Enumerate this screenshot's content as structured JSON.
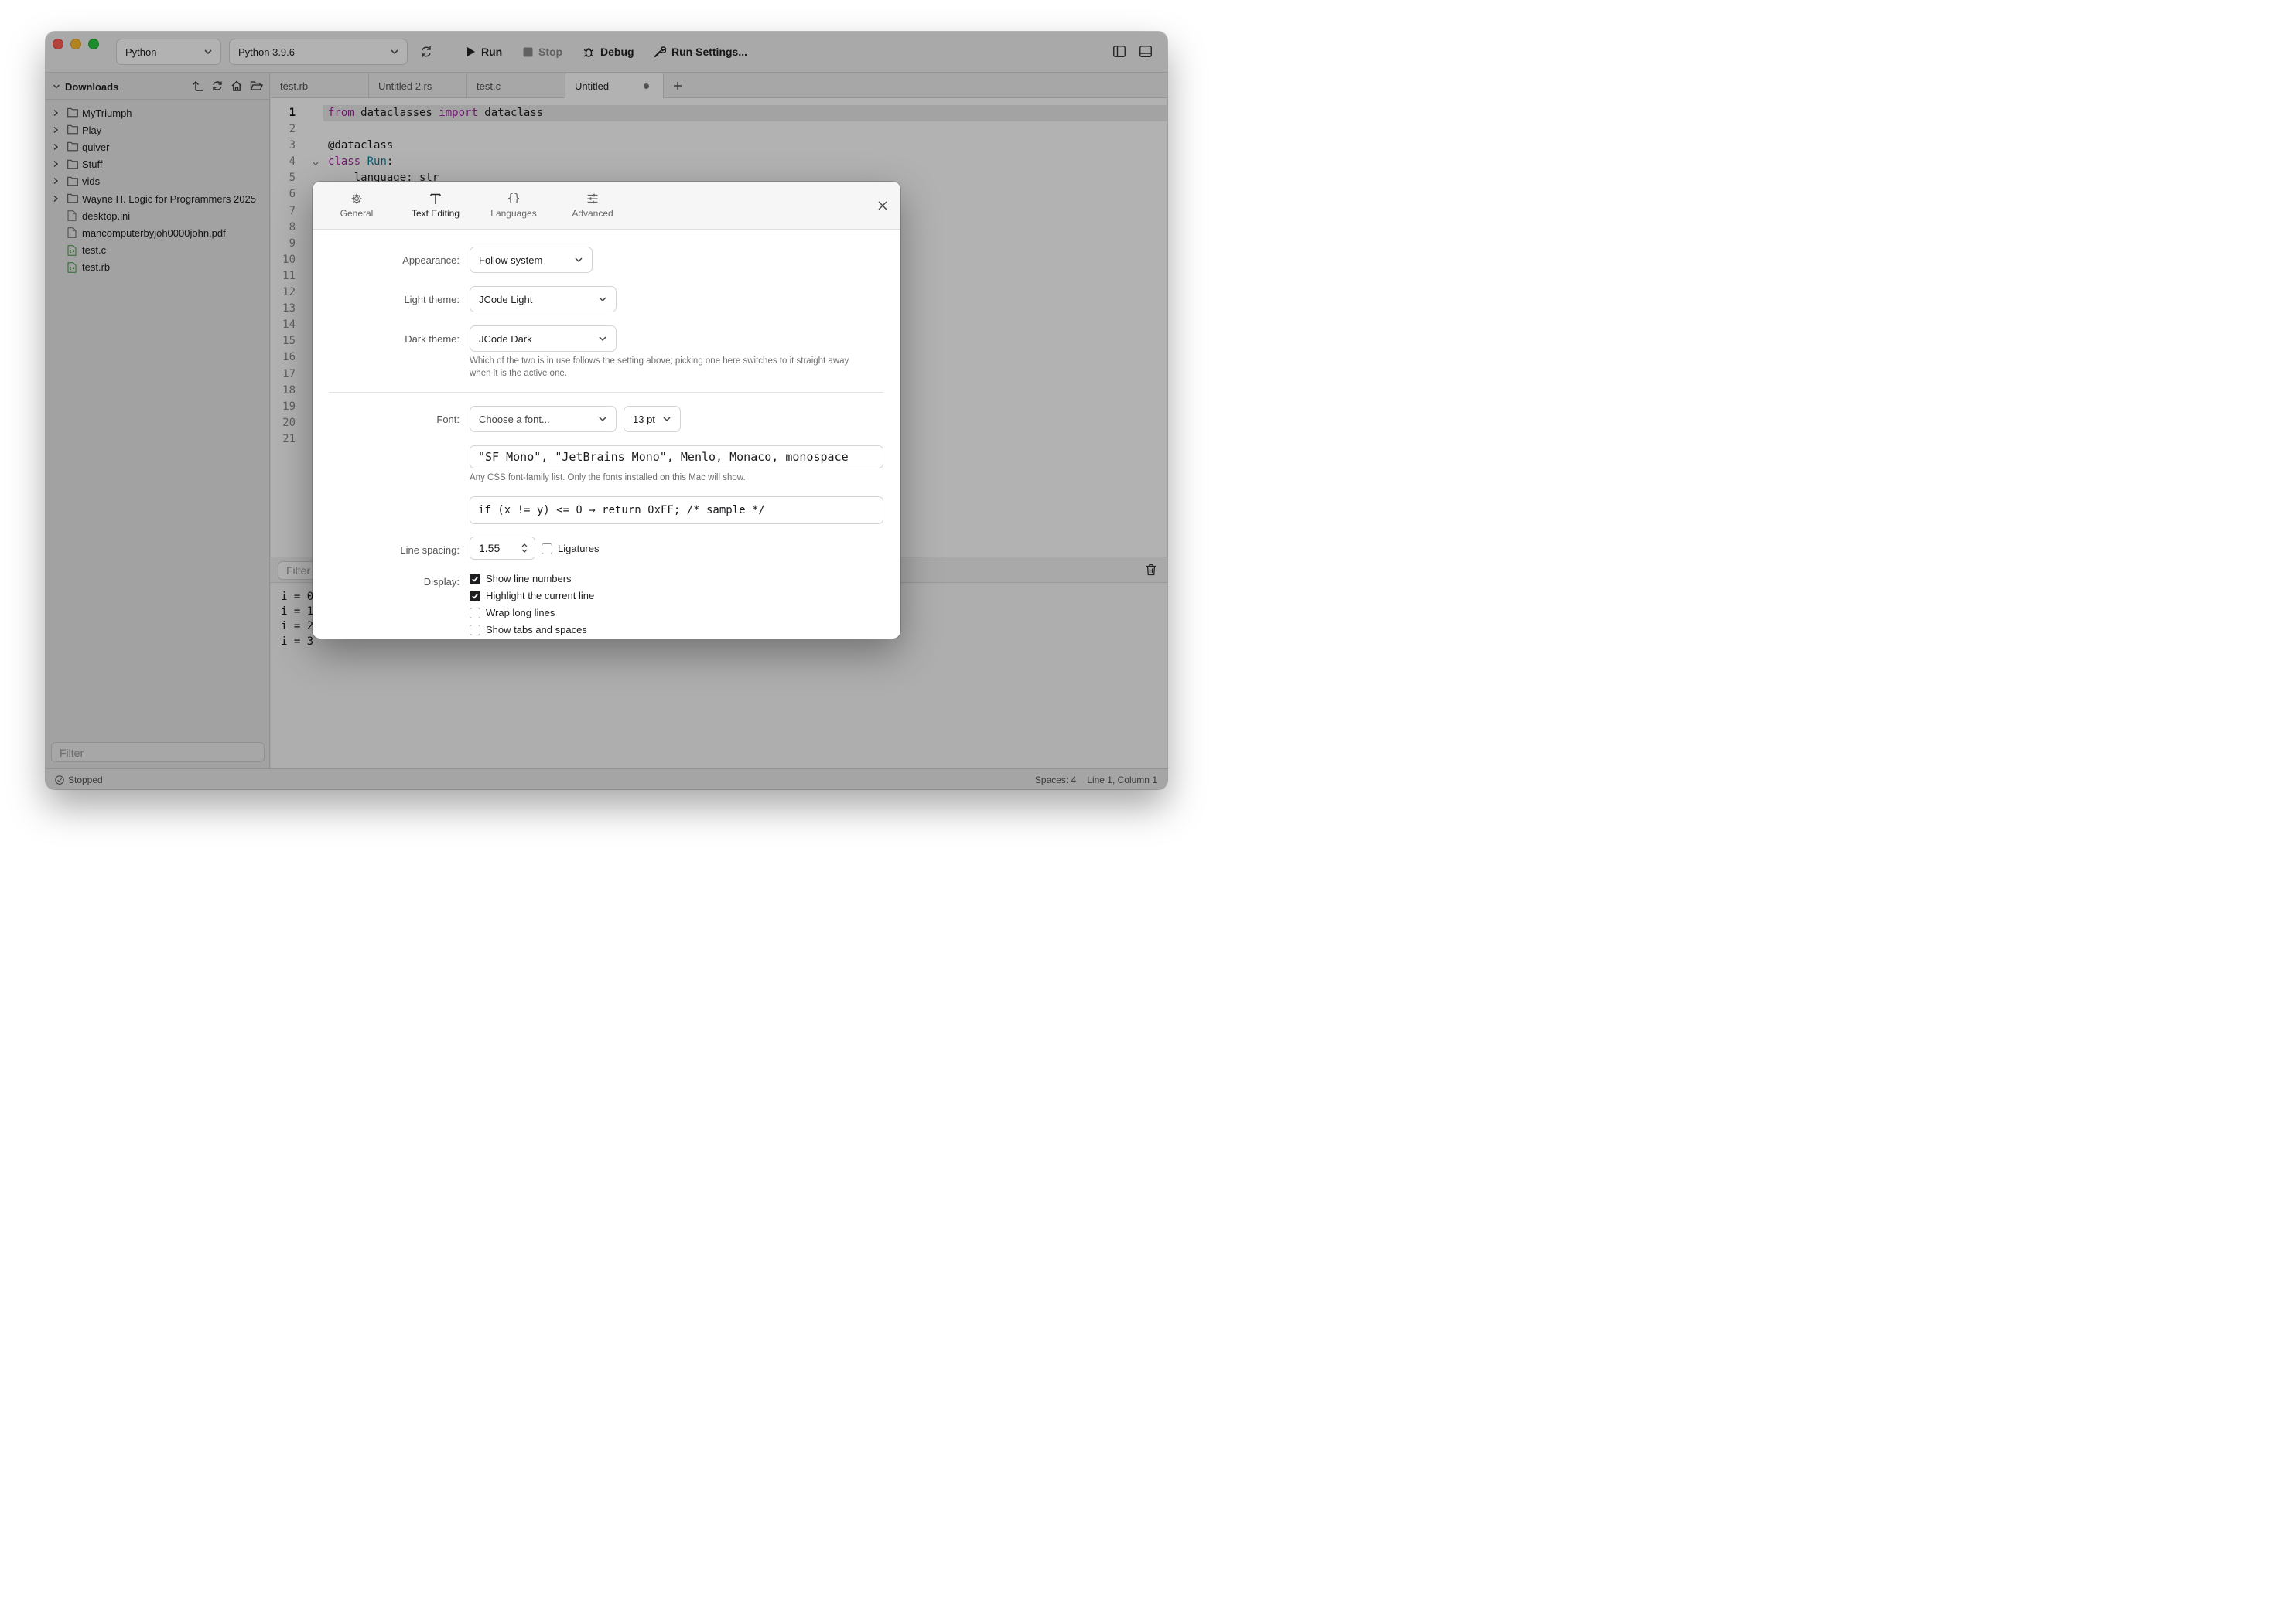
{
  "toolbar": {
    "language": "Python",
    "interpreter": "Python 3.9.6",
    "run_label": "Run",
    "stop_label": "Stop",
    "debug_label": "Debug",
    "run_settings_label": "Run Settings..."
  },
  "sidebar": {
    "title": "Downloads",
    "items": [
      {
        "label": "MyTriumph",
        "type": "folder"
      },
      {
        "label": "Play",
        "type": "folder"
      },
      {
        "label": "quiver",
        "type": "folder"
      },
      {
        "label": "Stuff",
        "type": "folder"
      },
      {
        "label": "vids",
        "type": "folder"
      },
      {
        "label": "Wayne H. Logic for Programmers 2025",
        "type": "folder"
      },
      {
        "label": "desktop.ini",
        "type": "file"
      },
      {
        "label": "mancomputerbyjoh0000john.pdf",
        "type": "file"
      },
      {
        "label": "test.c",
        "type": "code"
      },
      {
        "label": "test.rb",
        "type": "code"
      }
    ],
    "filter_placeholder": "Filter"
  },
  "editor": {
    "tabs": [
      {
        "label": "test.rb"
      },
      {
        "label": "Untitled 2.rs"
      },
      {
        "label": "test.c"
      },
      {
        "label": "Untitled"
      }
    ],
    "line_numbers": [
      "1",
      "2",
      "3",
      "4",
      "5",
      "6",
      "7",
      "8",
      "9",
      "10",
      "11",
      "12",
      "13",
      "14",
      "15",
      "16",
      "17",
      "18",
      "19",
      "20",
      "21"
    ],
    "code": {
      "l1_kw1": "from",
      "l1_mid": " dataclasses ",
      "l1_kw2": "import",
      "l1_end": " dataclass",
      "l3": "@dataclass",
      "l4_kw": "class",
      "l4_sp": " ",
      "l4_name": "Run",
      "l4_end": ":",
      "l5": "    language: str"
    }
  },
  "console": {
    "filter_placeholder": "Filter",
    "lines": [
      "i = 0",
      "i = 1",
      "i = 2",
      "i = 3"
    ]
  },
  "statusbar": {
    "state": "Stopped",
    "spaces": "Spaces: 4",
    "position": "Line 1, Column 1"
  },
  "settings": {
    "tabs": [
      "General",
      "Text Editing",
      "Languages",
      "Advanced"
    ],
    "active_tab": "Text Editing",
    "appearance_label": "Appearance:",
    "appearance_value": "Follow system",
    "light_theme_label": "Light theme:",
    "light_theme_value": "JCode Light",
    "dark_theme_label": "Dark theme:",
    "dark_theme_value": "JCode Dark",
    "theme_hint": "Which of the two is in use follows the setting above; picking one here switches to it straight away when it is the active one.",
    "font_label": "Font:",
    "font_placeholder": "Choose a font...",
    "font_size": "13 pt",
    "font_family_value": "\"SF Mono\", \"JetBrains Mono\", Menlo, Monaco, monospace",
    "font_hint": "Any CSS font-family list. Only the fonts installed on this Mac will show.",
    "preview_text": "if (x != y) <= 0 → return 0xFF; /* sample */",
    "line_spacing_label": "Line spacing:",
    "line_spacing_value": "1.55",
    "ligatures_label": "Ligatures",
    "ligatures_checked": false,
    "display_label": "Display:",
    "display_options": [
      {
        "label": "Show line numbers",
        "checked": true
      },
      {
        "label": "Highlight the current line",
        "checked": true
      },
      {
        "label": "Wrap long lines",
        "checked": false
      },
      {
        "label": "Show tabs and spaces",
        "checked": false
      }
    ]
  },
  "colors": {
    "keyword": "#a626a4",
    "class_name": "#0e7fa0",
    "close_light": "#ff5f57",
    "minimize_light": "#febc2e",
    "zoom_light": "#28c840"
  }
}
